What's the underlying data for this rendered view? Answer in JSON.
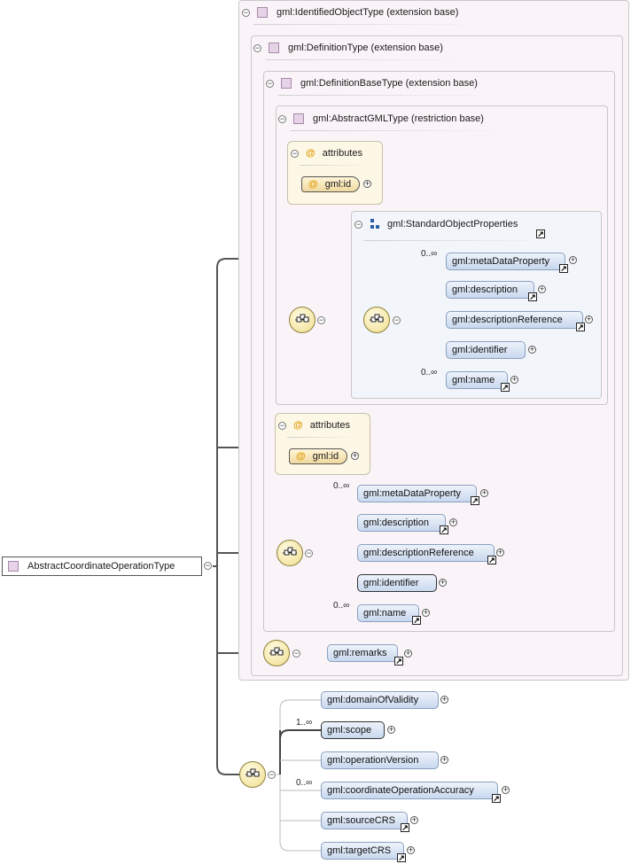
{
  "root": {
    "label": "AbstractCoordinateOperationType"
  },
  "ext_identified": {
    "label": "gml:IdentifiedObjectType (extension base)"
  },
  "ext_definition": {
    "label": "gml:DefinitionType (extension base)"
  },
  "ext_definitionbase": {
    "label": "gml:DefinitionBaseType (extension base)"
  },
  "restr_abstractgml": {
    "label": "gml:AbstractGMLType (restriction base)"
  },
  "attributes_label": "attributes",
  "attr_id": "gml:id",
  "at_symbol": "@",
  "group_label": "gml:StandardObjectProperties",
  "group_elements": [
    {
      "label": "gml:metaDataProperty",
      "card": "0..∞"
    },
    {
      "label": "gml:description",
      "card": ""
    },
    {
      "label": "gml:descriptionReference",
      "card": ""
    },
    {
      "label": "gml:identifier",
      "card": ""
    },
    {
      "label": "gml:name",
      "card": "0..∞"
    }
  ],
  "def_elements": [
    {
      "label": "gml:metaDataProperty",
      "card": "0..∞"
    },
    {
      "label": "gml:description",
      "card": ""
    },
    {
      "label": "gml:descriptionReference",
      "card": ""
    },
    {
      "label": "gml:identifier",
      "card": ""
    },
    {
      "label": "gml:name",
      "card": "0..∞"
    }
  ],
  "remarks": {
    "label": "gml:remarks"
  },
  "op_elements": [
    {
      "label": "gml:domainOfValidity",
      "card": ""
    },
    {
      "label": "gml:scope",
      "card": "1..∞"
    },
    {
      "label": "gml:operationVersion",
      "card": ""
    },
    {
      "label": "gml:coordinateOperationAccuracy",
      "card": "0..∞"
    },
    {
      "label": "gml:sourceCRS",
      "card": ""
    },
    {
      "label": "gml:targetCRS",
      "card": ""
    }
  ],
  "colors": {
    "element_fill": "#c8d8ee",
    "attribute_fill": "#f0d9a0",
    "container_fill": "#faf4f8",
    "sequence_fill": "#f0dd8c"
  }
}
